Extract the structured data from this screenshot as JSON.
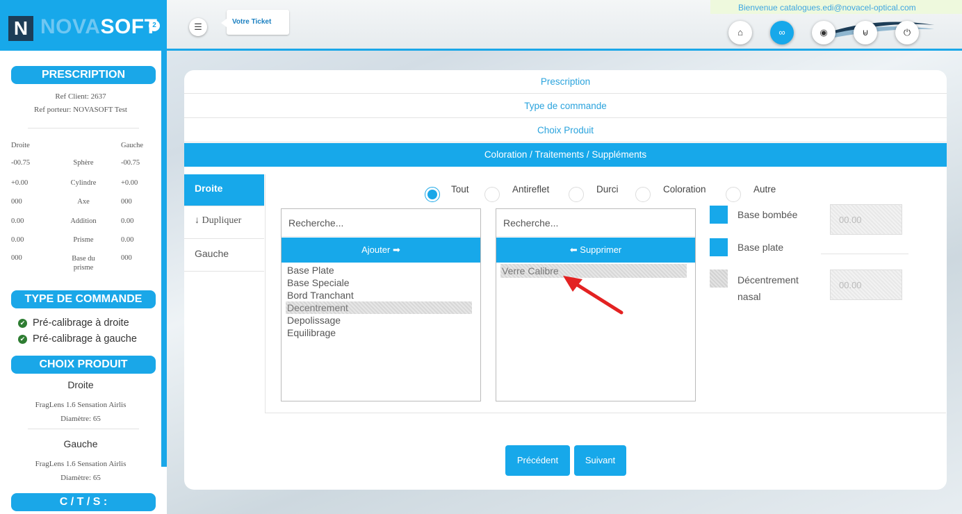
{
  "brand": {
    "logo_letter": "N",
    "name_part1": "NOVA",
    "name_part2": "SOFT",
    "superscript": "2"
  },
  "sidebar": {
    "prescription": {
      "title": "PRESCRIPTION",
      "ref_client": "Ref Client: 2637",
      "ref_porteur": "Ref porteur: NOVASOFT Test",
      "col_left": "Droite",
      "col_right": "Gauche",
      "rows": [
        {
          "left": "-00.75",
          "label": "Sphère",
          "right": "-00.75"
        },
        {
          "left": "+0.00",
          "label": "Cylindre",
          "right": "+0.00"
        },
        {
          "left": "000",
          "label": "Axe",
          "right": "000"
        },
        {
          "left": "0.00",
          "label": "Addition",
          "right": "0.00"
        },
        {
          "left": "0.00",
          "label": "Prisme",
          "right": "0.00"
        },
        {
          "left": "000",
          "label": "Base du prisme",
          "right": "000"
        }
      ]
    },
    "type_commande": {
      "title": "TYPE DE COMMANDE",
      "items": [
        "Pré-calibrage à droite",
        "Pré-calibrage à gauche"
      ]
    },
    "choix_produit": {
      "title": "CHOIX PRODUIT",
      "droite_title": "Droite",
      "droite_product": "FragLens 1.6 Sensation Airlis",
      "droite_diam": "Diamètre: 65",
      "gauche_title": "Gauche",
      "gauche_product": "FragLens 1.6 Sensation Airlis",
      "gauche_diam": "Diamètre: 65"
    },
    "cts_title": "C / T / S :"
  },
  "header": {
    "menu_icon": "menu-icon",
    "ticket_label": "Votre Ticket",
    "welcome": "Bienvenue catalogues.edi@novacel-optical.com",
    "buttons": [
      "home-icon",
      "glasses-icon",
      "eye-icon",
      "cart-icon",
      "power-icon"
    ]
  },
  "accordion": [
    "Prescription",
    "Type de commande",
    "Choix Produit",
    "Coloration / Traitements / Suppléments"
  ],
  "eye_tabs": {
    "droite": "Droite",
    "dupliquer": "Dupliquer",
    "gauche": "Gauche"
  },
  "filters": {
    "options": [
      "Tout",
      "Antireflet",
      "Durci",
      "Coloration",
      "Autre"
    ],
    "selected": "Tout"
  },
  "available": {
    "placeholder": "Recherche...",
    "action": "Ajouter",
    "items": [
      "Base Plate",
      "Base Speciale",
      "Bord Tranchant",
      "Decentrement",
      "Depolissage",
      "Equilibrage"
    ],
    "selected": "Decentrement"
  },
  "chosen": {
    "placeholder": "Recherche...",
    "action": "Supprimer",
    "items": [
      "Verre Calibre"
    ],
    "selected": "Verre Calibre"
  },
  "options": {
    "base_bombee": "Base bombée",
    "base_bombee_value": "00.00",
    "base_plate": "Base plate",
    "decentrement": "Décentrement nasal",
    "decentrement_value": "00.00"
  },
  "navigation": {
    "previous": "Précédent",
    "next": "Suivant"
  },
  "colors": {
    "accent": "#17a8ea",
    "logo_dark": "#1d3d57",
    "arrow": "#e32222"
  }
}
